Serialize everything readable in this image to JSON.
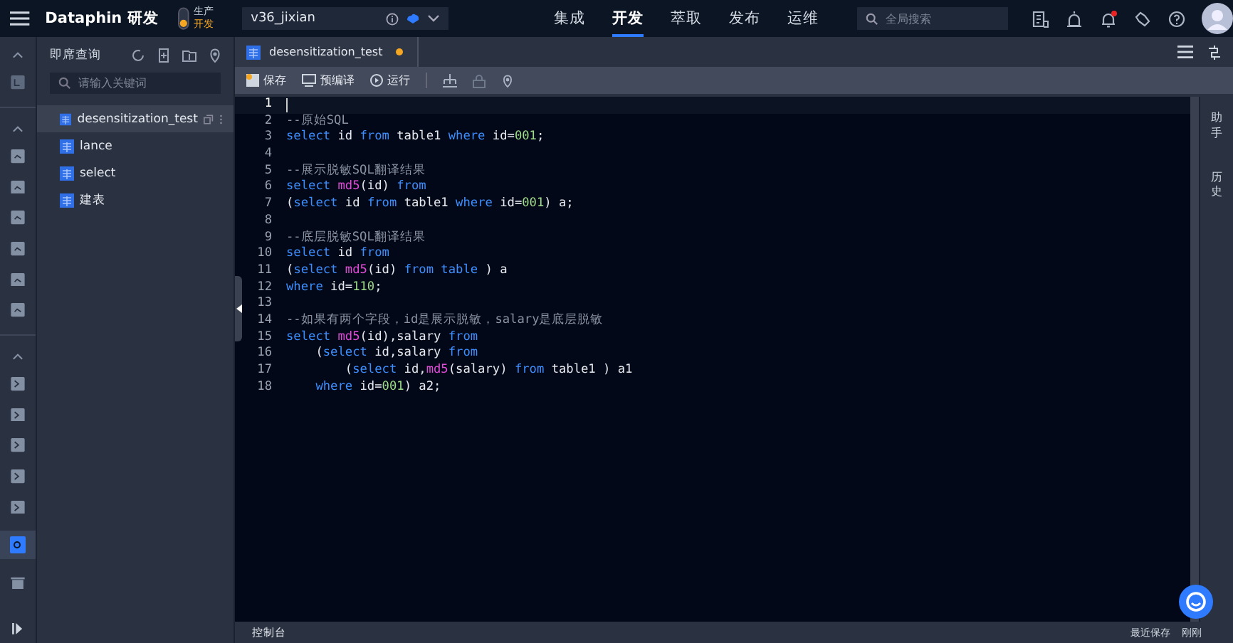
{
  "topbar": {
    "brand": "Dataphin 研发",
    "env": [
      "生产",
      "开发"
    ],
    "project": "v36_jixian",
    "nav": [
      {
        "label": "集成",
        "selected": false
      },
      {
        "label": "开发",
        "selected": true
      },
      {
        "label": "萃取",
        "selected": false
      },
      {
        "label": "发布",
        "selected": false
      },
      {
        "label": "运维",
        "selected": false
      }
    ],
    "search": {
      "placeholder": "全局搜索"
    }
  },
  "sidebar": {
    "title": "即席查询",
    "search": {
      "placeholder": "请输入关键词"
    },
    "items": [
      {
        "label": "desensitization_test",
        "selected": true
      },
      {
        "label": "lance",
        "selected": false
      },
      {
        "label": "select",
        "selected": false
      },
      {
        "label": "建表",
        "selected": false
      }
    ]
  },
  "tabs": [
    {
      "label": "desensitization_test",
      "selected": true,
      "unsaved": true
    }
  ],
  "toolbar": [
    "保存",
    "预编译",
    "运行"
  ],
  "editor": {
    "lines": [
      {
        "number": "1"
      },
      {
        "number": "2",
        "tokens": [
          {
            "kind": "comment",
            "text": "--原始SQL"
          }
        ]
      },
      {
        "number": "3",
        "tokens": [
          {
            "kind": "keyword",
            "text": "select"
          },
          {
            "kind": "plain",
            "text": " id "
          },
          {
            "kind": "keyword",
            "text": "from"
          },
          {
            "kind": "plain",
            "text": " table1 "
          },
          {
            "kind": "keyword",
            "text": "where"
          },
          {
            "kind": "plain",
            "text": " id="
          },
          {
            "kind": "number",
            "text": "001"
          },
          {
            "kind": "plain",
            "text": ";"
          }
        ]
      },
      {
        "number": "4"
      },
      {
        "number": "5",
        "tokens": [
          {
            "kind": "comment",
            "text": "--展示脱敏SQL翻译结果"
          }
        ]
      },
      {
        "number": "6",
        "tokens": [
          {
            "kind": "keyword",
            "text": "select "
          },
          {
            "kind": "function",
            "text": "md5"
          },
          {
            "kind": "plain",
            "text": "(id) "
          },
          {
            "kind": "keyword",
            "text": "from"
          }
        ]
      },
      {
        "number": "7",
        "tokens": [
          {
            "kind": "plain",
            "text": "("
          },
          {
            "kind": "keyword",
            "text": "select"
          },
          {
            "kind": "plain",
            "text": " id "
          },
          {
            "kind": "keyword",
            "text": "from"
          },
          {
            "kind": "plain",
            "text": " table1 "
          },
          {
            "kind": "keyword",
            "text": "where"
          },
          {
            "kind": "plain",
            "text": " id="
          },
          {
            "kind": "number",
            "text": "001"
          },
          {
            "kind": "plain",
            "text": ") a;"
          }
        ]
      },
      {
        "number": "8"
      },
      {
        "number": "9",
        "tokens": [
          {
            "kind": "comment",
            "text": "--底层脱敏SQL翻译结果"
          }
        ]
      },
      {
        "number": "10",
        "tokens": [
          {
            "kind": "keyword",
            "text": "select"
          },
          {
            "kind": "plain",
            "text": " id "
          },
          {
            "kind": "keyword",
            "text": "from"
          }
        ]
      },
      {
        "number": "11",
        "tokens": [
          {
            "kind": "plain",
            "text": "("
          },
          {
            "kind": "keyword",
            "text": "select "
          },
          {
            "kind": "function",
            "text": "md5"
          },
          {
            "kind": "plain",
            "text": "(id) "
          },
          {
            "kind": "keyword",
            "text": "from table"
          },
          {
            "kind": "plain",
            "text": " ) a"
          }
        ]
      },
      {
        "number": "12",
        "tokens": [
          {
            "kind": "keyword",
            "text": "where"
          },
          {
            "kind": "plain",
            "text": " id="
          },
          {
            "kind": "number",
            "text": "110"
          },
          {
            "kind": "plain",
            "text": ";"
          }
        ]
      },
      {
        "number": "13"
      },
      {
        "number": "14",
        "tokens": [
          {
            "kind": "comment",
            "text": "--如果有两个字段，id是展示脱敏，salary是底层脱敏"
          }
        ]
      },
      {
        "number": "15",
        "tokens": [
          {
            "kind": "keyword",
            "text": "select "
          },
          {
            "kind": "function",
            "text": "md5"
          },
          {
            "kind": "plain",
            "text": "(id),salary "
          },
          {
            "kind": "keyword",
            "text": "from"
          }
        ]
      },
      {
        "number": "16",
        "tokens": [
          {
            "kind": "plain",
            "text": "    ("
          },
          {
            "kind": "keyword",
            "text": "select"
          },
          {
            "kind": "plain",
            "text": " id,salary "
          },
          {
            "kind": "keyword",
            "text": "from"
          }
        ]
      },
      {
        "number": "17",
        "tokens": [
          {
            "kind": "plain",
            "text": "        ("
          },
          {
            "kind": "keyword",
            "text": "select"
          },
          {
            "kind": "plain",
            "text": " id,"
          },
          {
            "kind": "function",
            "text": "md5"
          },
          {
            "kind": "plain",
            "text": "(salary) "
          },
          {
            "kind": "keyword",
            "text": "from"
          },
          {
            "kind": "plain",
            "text": " table1 ) a1"
          }
        ]
      },
      {
        "number": "18",
        "tokens": [
          {
            "kind": "keyword",
            "text": "    where"
          },
          {
            "kind": "plain",
            "text": " id="
          },
          {
            "kind": "number",
            "text": "001"
          },
          {
            "kind": "plain",
            "text": ") a2;"
          }
        ]
      }
    ]
  },
  "right_rail": [
    "助手",
    "历史"
  ],
  "bottom": {
    "console": "控制台",
    "saved_label": "最近保存",
    "saved_time": "刚刚"
  }
}
